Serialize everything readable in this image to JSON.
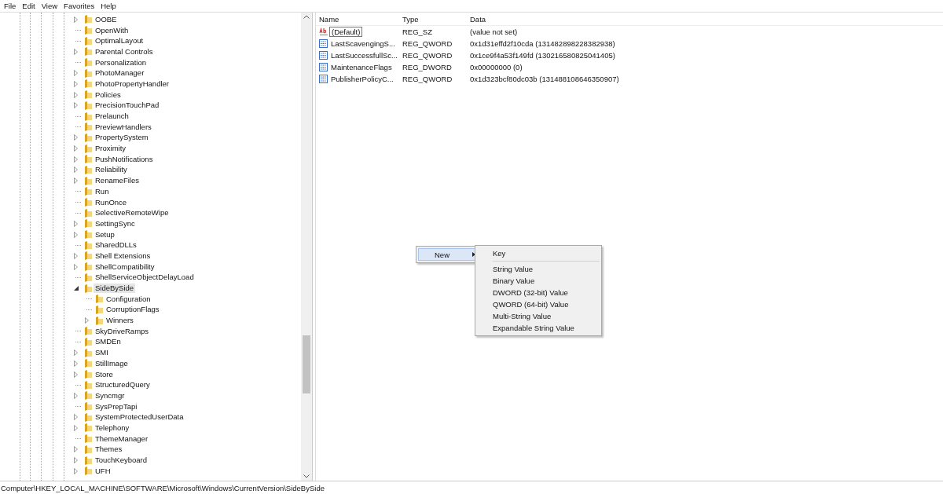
{
  "menu_bar": [
    "File",
    "Edit",
    "View",
    "Favorites",
    "Help"
  ],
  "tree": [
    {
      "label": "OOBE",
      "expandable": true,
      "expanded": false,
      "selected": false
    },
    {
      "label": "OpenWith",
      "expandable": false,
      "selected": false
    },
    {
      "label": "OptimalLayout",
      "expandable": false,
      "selected": false
    },
    {
      "label": "Parental Controls",
      "expandable": true,
      "expanded": false,
      "selected": false
    },
    {
      "label": "Personalization",
      "expandable": false,
      "selected": false
    },
    {
      "label": "PhotoManager",
      "expandable": true,
      "expanded": false,
      "selected": false
    },
    {
      "label": "PhotoPropertyHandler",
      "expandable": true,
      "expanded": false,
      "selected": false
    },
    {
      "label": "Policies",
      "expandable": true,
      "expanded": false,
      "selected": false
    },
    {
      "label": "PrecisionTouchPad",
      "expandable": true,
      "expanded": false,
      "selected": false
    },
    {
      "label": "Prelaunch",
      "expandable": false,
      "selected": false
    },
    {
      "label": "PreviewHandlers",
      "expandable": false,
      "selected": false
    },
    {
      "label": "PropertySystem",
      "expandable": true,
      "expanded": false,
      "selected": false
    },
    {
      "label": "Proximity",
      "expandable": true,
      "expanded": false,
      "selected": false
    },
    {
      "label": "PushNotifications",
      "expandable": true,
      "expanded": false,
      "selected": false
    },
    {
      "label": "Reliability",
      "expandable": true,
      "expanded": false,
      "selected": false
    },
    {
      "label": "RenameFiles",
      "expandable": true,
      "expanded": false,
      "selected": false
    },
    {
      "label": "Run",
      "expandable": false,
      "selected": false
    },
    {
      "label": "RunOnce",
      "expandable": false,
      "selected": false
    },
    {
      "label": "SelectiveRemoteWipe",
      "expandable": false,
      "selected": false
    },
    {
      "label": "SettingSync",
      "expandable": true,
      "expanded": false,
      "selected": false
    },
    {
      "label": "Setup",
      "expandable": true,
      "expanded": false,
      "selected": false
    },
    {
      "label": "SharedDLLs",
      "expandable": false,
      "selected": false
    },
    {
      "label": "Shell Extensions",
      "expandable": true,
      "expanded": false,
      "selected": false
    },
    {
      "label": "ShellCompatibility",
      "expandable": true,
      "expanded": false,
      "selected": false
    },
    {
      "label": "ShellServiceObjectDelayLoad",
      "expandable": false,
      "selected": false
    },
    {
      "label": "SideBySide",
      "expandable": true,
      "expanded": true,
      "selected": true,
      "children": [
        {
          "label": "Configuration",
          "expandable": false,
          "selected": false
        },
        {
          "label": "CorruptionFlags",
          "expandable": false,
          "selected": false
        },
        {
          "label": "Winners",
          "expandable": true,
          "expanded": false,
          "selected": false
        }
      ]
    },
    {
      "label": "SkyDriveRamps",
      "expandable": false,
      "selected": false
    },
    {
      "label": "SMDEn",
      "expandable": false,
      "selected": false
    },
    {
      "label": "SMI",
      "expandable": true,
      "expanded": false,
      "selected": false
    },
    {
      "label": "StillImage",
      "expandable": true,
      "expanded": false,
      "selected": false
    },
    {
      "label": "Store",
      "expandable": true,
      "expanded": false,
      "selected": false
    },
    {
      "label": "StructuredQuery",
      "expandable": false,
      "selected": false
    },
    {
      "label": "Syncmgr",
      "expandable": true,
      "expanded": false,
      "selected": false
    },
    {
      "label": "SysPrepTapi",
      "expandable": false,
      "selected": false
    },
    {
      "label": "SystemProtectedUserData",
      "expandable": true,
      "expanded": false,
      "selected": false
    },
    {
      "label": "Telephony",
      "expandable": true,
      "expanded": false,
      "selected": false
    },
    {
      "label": "ThemeManager",
      "expandable": false,
      "selected": false
    },
    {
      "label": "Themes",
      "expandable": true,
      "expanded": false,
      "selected": false
    },
    {
      "label": "TouchKeyboard",
      "expandable": true,
      "expanded": false,
      "selected": false
    },
    {
      "label": "UFH",
      "expandable": true,
      "expanded": false,
      "selected": false
    }
  ],
  "values": {
    "columns": [
      "Name",
      "Type",
      "Data"
    ],
    "rows": [
      {
        "kind": "string",
        "name": "(Default)",
        "type": "REG_SZ",
        "data": "(value not set)",
        "focused": true
      },
      {
        "kind": "binary",
        "name": "LastScavengingS...",
        "type": "REG_QWORD",
        "data": "0x1d31effd2f10cda (131482898228382938)",
        "focused": false
      },
      {
        "kind": "binary",
        "name": "LastSuccessfullSc...",
        "type": "REG_QWORD",
        "data": "0x1ce9f4a53f149fd (130216580825041405)",
        "focused": false
      },
      {
        "kind": "binary",
        "name": "MaintenanceFlags",
        "type": "REG_DWORD",
        "data": "0x00000000 (0)",
        "focused": false
      },
      {
        "kind": "binary",
        "name": "PublisherPolicyC...",
        "type": "REG_QWORD",
        "data": "0x1d323bcf80dc03b (131488108646350907)",
        "focused": false
      }
    ]
  },
  "context_menu": {
    "items": [
      {
        "label": "New",
        "submenu": true,
        "selected": true
      }
    ],
    "submenu": [
      {
        "kind": "item",
        "label": "Key"
      },
      {
        "kind": "separator"
      },
      {
        "kind": "item",
        "label": "String Value"
      },
      {
        "kind": "item",
        "label": "Binary Value"
      },
      {
        "kind": "item",
        "label": "DWORD (32-bit) Value"
      },
      {
        "kind": "item",
        "label": "QWORD (64-bit) Value"
      },
      {
        "kind": "item",
        "label": "Multi-String Value"
      },
      {
        "kind": "item",
        "label": "Expandable String Value"
      }
    ]
  },
  "status_bar": "Computer\\HKEY_LOCAL_MACHINE\\SOFTWARE\\Microsoft\\Windows\\CurrentVersion\\SideBySide"
}
